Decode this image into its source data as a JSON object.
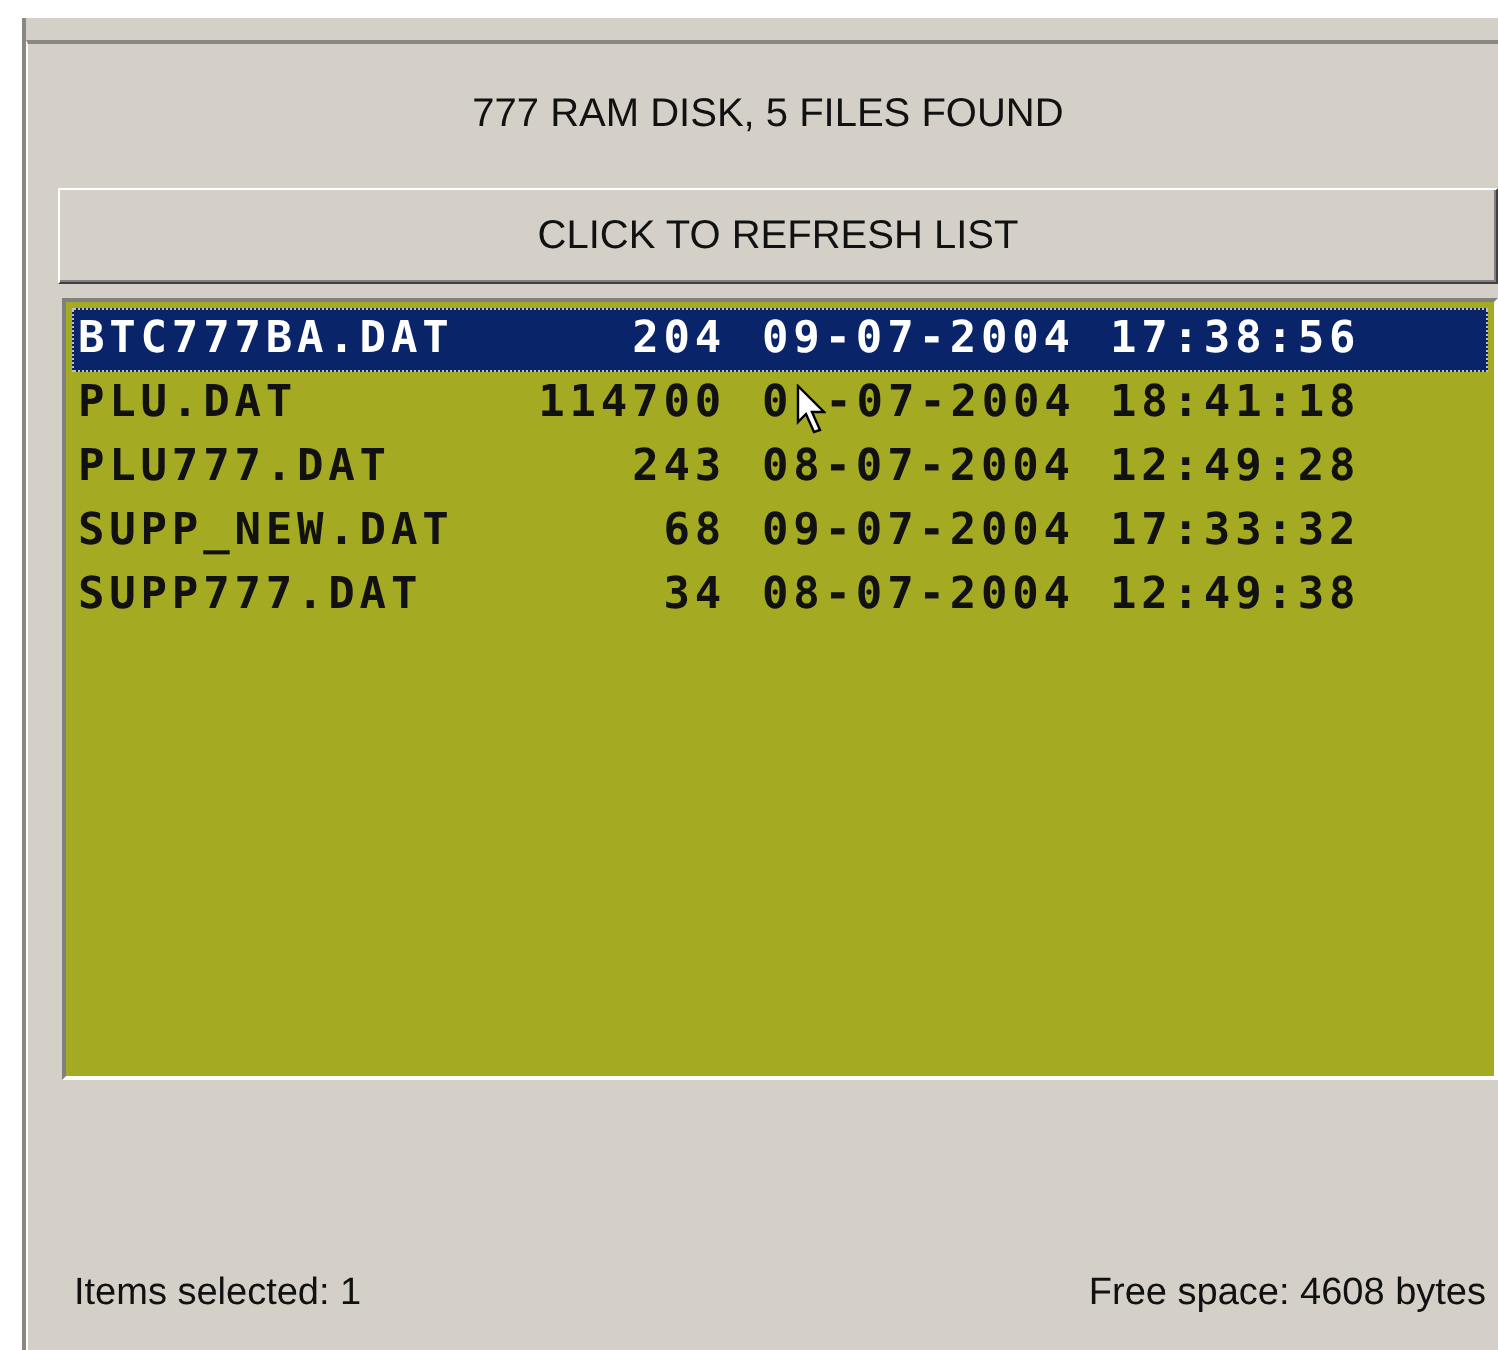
{
  "header": {
    "title": "777 RAM DISK, 5 FILES FOUND"
  },
  "refresh_button": {
    "label": "CLICK TO REFRESH LIST"
  },
  "file_list": {
    "rows": [
      {
        "name": "BTC777BA.DAT",
        "size": "204",
        "date": "09-07-2004",
        "time": "17:38:56",
        "selected": true
      },
      {
        "name": "PLU.DAT",
        "size": "114700",
        "date": [
          "0",
          "-07-2004"
        ],
        "pointer": true,
        "time": "18:41:18",
        "selected": false
      },
      {
        "name": "PLU777.DAT",
        "size": "243",
        "date": "08-07-2004",
        "time": "12:49:28",
        "selected": false
      },
      {
        "name": "SUPP_NEW.DAT",
        "size": "68",
        "date": "09-07-2004",
        "time": "17:33:32",
        "selected": false
      },
      {
        "name": "SUPP777.DAT",
        "size": "34",
        "date": "08-07-2004",
        "time": "12:49:38",
        "selected": false
      }
    ]
  },
  "status_bar": {
    "items_selected": "Items selected: 1",
    "free_space": "Free space: 4608 bytes"
  }
}
